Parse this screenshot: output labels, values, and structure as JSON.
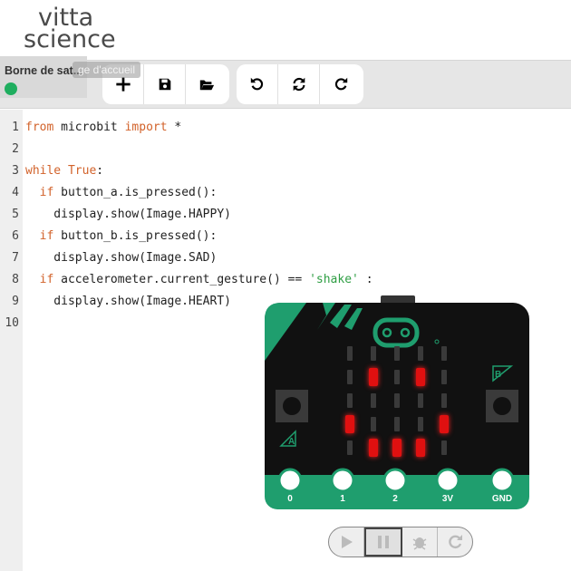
{
  "logo": {
    "line1": "vitta",
    "line2": "science"
  },
  "project": {
    "name": "Borne de sat...",
    "tooltip": "ge d'accueil",
    "status_color": "#1fae5f"
  },
  "toolbar": {
    "group1": [
      {
        "name": "new-file-button",
        "icon": "plus-icon"
      },
      {
        "name": "save-button",
        "icon": "floppy-icon"
      },
      {
        "name": "open-button",
        "icon": "folder-open-icon"
      }
    ],
    "group2": [
      {
        "name": "undo-button",
        "icon": "undo-icon"
      },
      {
        "name": "sync-button",
        "icon": "refresh-icon"
      },
      {
        "name": "redo-button",
        "icon": "redo-icon"
      }
    ]
  },
  "editor": {
    "lines": [
      {
        "num": "1",
        "tokens": [
          {
            "t": "from",
            "c": "kw"
          },
          {
            "t": " microbit ",
            "c": ""
          },
          {
            "t": "import",
            "c": "kw"
          },
          {
            "t": " *",
            "c": ""
          }
        ]
      },
      {
        "num": "2",
        "tokens": []
      },
      {
        "num": "3",
        "tokens": [
          {
            "t": "while",
            "c": "kw"
          },
          {
            "t": " ",
            "c": ""
          },
          {
            "t": "True",
            "c": "kw"
          },
          {
            "t": ":",
            "c": ""
          }
        ]
      },
      {
        "num": "4",
        "tokens": [
          {
            "t": "  ",
            "c": ""
          },
          {
            "t": "if",
            "c": "kw"
          },
          {
            "t": " button_a.is_pressed():",
            "c": ""
          }
        ]
      },
      {
        "num": "5",
        "tokens": [
          {
            "t": "    display.show(Image.HAPPY)",
            "c": ""
          }
        ]
      },
      {
        "num": "6",
        "tokens": [
          {
            "t": "  ",
            "c": ""
          },
          {
            "t": "if",
            "c": "kw"
          },
          {
            "t": " button_b.is_pressed():",
            "c": ""
          }
        ]
      },
      {
        "num": "7",
        "tokens": [
          {
            "t": "    display.show(Image.SAD)",
            "c": ""
          }
        ]
      },
      {
        "num": "8",
        "tokens": [
          {
            "t": "  ",
            "c": ""
          },
          {
            "t": "if",
            "c": "kw"
          },
          {
            "t": " accelerometer.current_gesture() == ",
            "c": ""
          },
          {
            "t": "'shake'",
            "c": "str"
          },
          {
            "t": " :",
            "c": ""
          }
        ]
      },
      {
        "num": "9",
        "tokens": [
          {
            "t": "    display.show(Image.HEART)",
            "c": ""
          }
        ]
      },
      {
        "num": "10",
        "tokens": []
      }
    ]
  },
  "simulator": {
    "button_a_label": "A",
    "button_b_label": "B",
    "pins": [
      "0",
      "1",
      "2",
      "3V",
      "GND"
    ],
    "led_matrix": [
      [
        0,
        0,
        0,
        0,
        0
      ],
      [
        0,
        1,
        0,
        1,
        0
      ],
      [
        0,
        0,
        0,
        0,
        0
      ],
      [
        1,
        0,
        0,
        0,
        1
      ],
      [
        0,
        1,
        1,
        1,
        0
      ]
    ],
    "controls": [
      {
        "name": "play-button",
        "icon": "play-icon"
      },
      {
        "name": "pause-button",
        "icon": "pause-icon"
      },
      {
        "name": "debug-button",
        "icon": "bug-icon"
      },
      {
        "name": "reset-button",
        "icon": "reset-icon"
      }
    ],
    "colors": {
      "board": "#111111",
      "accent": "#1f9e6e",
      "led_on": "#e01010",
      "led_off": "#3a3a3a"
    }
  }
}
